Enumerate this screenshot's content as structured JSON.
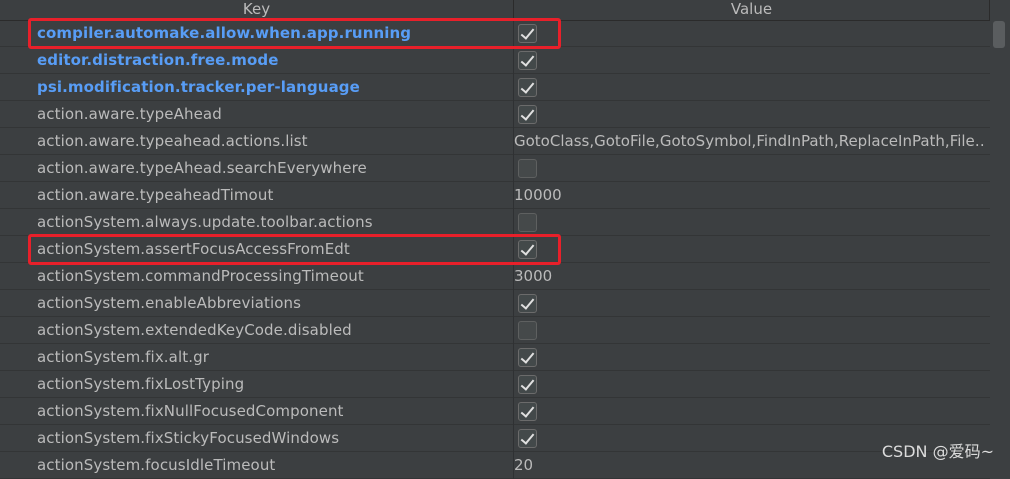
{
  "header": {
    "key_label": "Key",
    "value_label": "Value"
  },
  "rows": [
    {
      "key": "compiler.automake.allow.when.app.running",
      "type": "checkbox",
      "checked": true,
      "modified": true
    },
    {
      "key": "editor.distraction.free.mode",
      "type": "checkbox",
      "checked": true,
      "modified": true
    },
    {
      "key": "psi.modification.tracker.per-language",
      "type": "checkbox",
      "checked": true,
      "modified": true
    },
    {
      "key": "action.aware.typeAhead",
      "type": "checkbox",
      "checked": true,
      "modified": false
    },
    {
      "key": "action.aware.typeahead.actions.list",
      "type": "text",
      "value": "GotoClass,GotoFile,GotoSymbol,FindInPath,ReplaceInPath,File…",
      "modified": false
    },
    {
      "key": "action.aware.typeAhead.searchEverywhere",
      "type": "checkbox",
      "checked": false,
      "modified": false
    },
    {
      "key": "action.aware.typeaheadTimout",
      "type": "text",
      "value": "10000",
      "modified": false
    },
    {
      "key": "actionSystem.always.update.toolbar.actions",
      "type": "checkbox",
      "checked": false,
      "modified": false
    },
    {
      "key": "actionSystem.assertFocusAccessFromEdt",
      "type": "checkbox",
      "checked": true,
      "modified": false
    },
    {
      "key": "actionSystem.commandProcessingTimeout",
      "type": "text",
      "value": "3000",
      "modified": false
    },
    {
      "key": "actionSystem.enableAbbreviations",
      "type": "checkbox",
      "checked": true,
      "modified": false
    },
    {
      "key": "actionSystem.extendedKeyCode.disabled",
      "type": "checkbox",
      "checked": false,
      "modified": false
    },
    {
      "key": "actionSystem.fix.alt.gr",
      "type": "checkbox",
      "checked": true,
      "modified": false
    },
    {
      "key": "actionSystem.fixLostTyping",
      "type": "checkbox",
      "checked": true,
      "modified": false
    },
    {
      "key": "actionSystem.fixNullFocusedComponent",
      "type": "checkbox",
      "checked": true,
      "modified": false
    },
    {
      "key": "actionSystem.fixStickyFocusedWindows",
      "type": "checkbox",
      "checked": true,
      "modified": false
    },
    {
      "key": "actionSystem.focusIdleTimeout",
      "type": "text",
      "value": "20",
      "modified": false
    }
  ],
  "highlighted_rows": [
    0,
    8
  ],
  "watermark": "CSDN @爱码~",
  "colors": {
    "background": "#3c3f41",
    "modified_key": "#589df6",
    "highlight": "#e8202a"
  }
}
